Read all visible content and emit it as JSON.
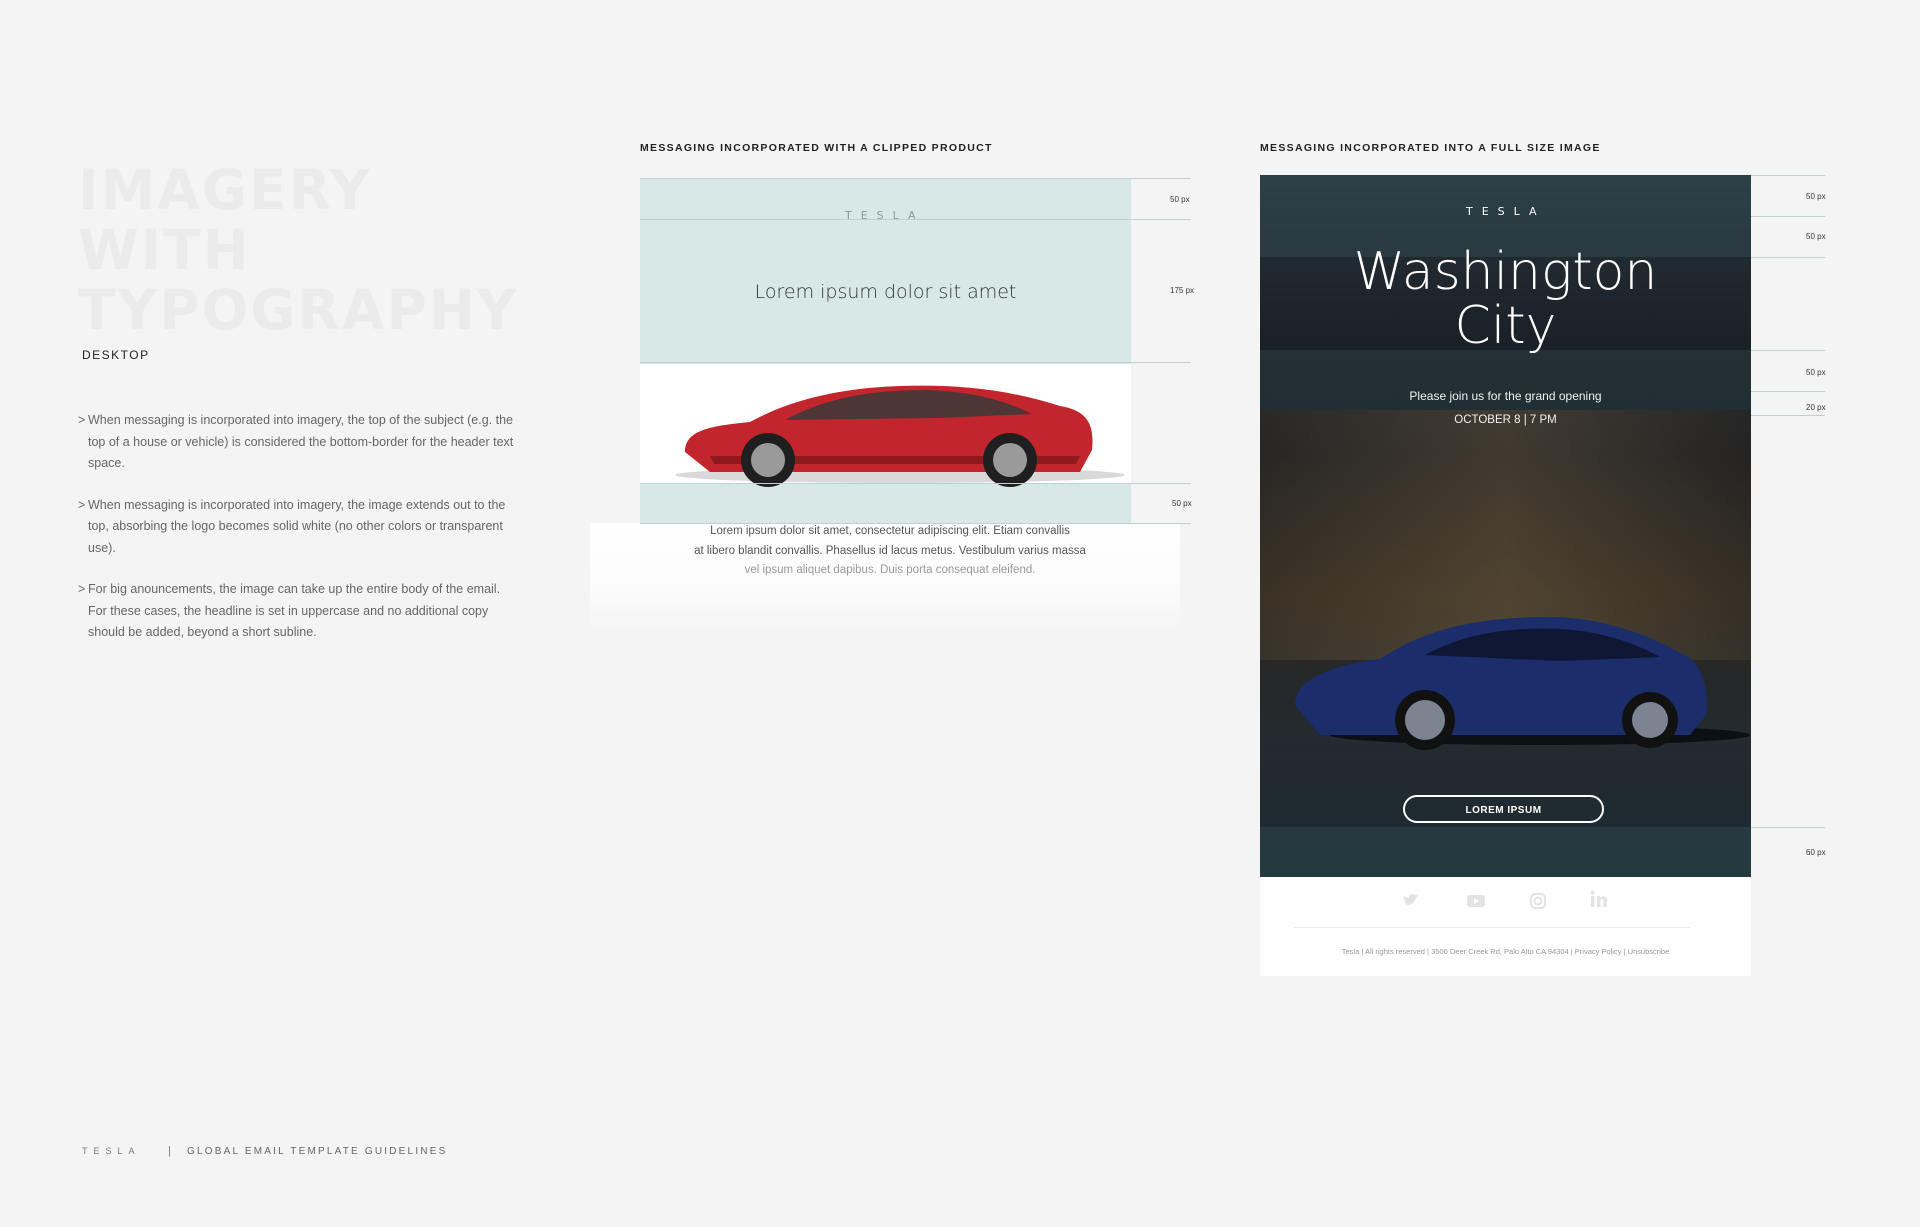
{
  "left": {
    "title_lines": [
      "IMAGERY",
      "WITH",
      "TYPOGRAPHY"
    ],
    "subhead": "DESKTOP",
    "bullets": [
      {
        "mark": ">",
        "text": "When messaging is incorporated into imagery, the top of the subject (e.g. the top of a house or vehicle) is considered the bottom-border for the header text space."
      },
      {
        "mark": ">",
        "text": "When messaging is incorporated into imagery, the image extends out to the top, absorbing the logo becomes solid white (no other colors or transparent use)."
      },
      {
        "mark": ">",
        "text": "For big anouncements, the image can take up the entire body of the email. For these cases, the headline is set in uppercase and no additional copy should be added, beyond a short subline."
      }
    ]
  },
  "clipped": {
    "label": "MESSAGING INCORPORATED WITH A CLIPPED PRODUCT",
    "logo": "TESLA",
    "headline": "Lorem ipsum dolor sit amet",
    "body_lines": [
      "Lorem ipsum dolor sit amet, consectetur adipiscing elit. Etiam convallis",
      "at libero blandit convallis. Phasellus id lacus metus. Vestibulum varius massa",
      "vel ipsum aliquet dapibus. Duis porta consequat eleifend."
    ],
    "px_labels": [
      "50 px",
      "175 px",
      "50 px"
    ]
  },
  "full": {
    "label": "MESSAGING INCORPORATED INTO A FULL SIZE IMAGE",
    "logo": "TESLA",
    "headline_lines": [
      "Washington",
      "City"
    ],
    "invite": "Please join us for the grand opening",
    "date": "OCTOBER 8 | 7 PM",
    "cta": "LOREM IPSUM",
    "px_labels": [
      "50 px",
      "50 px",
      "50 px",
      "20 px",
      "60 px"
    ],
    "footer": "Tesla  |  All rights reserved  |  3500 Deer Creek Rd, Palo Alto CA 94304  |  Privacy Policy  |  Unsubscribe",
    "social_icons": [
      "twitter-icon",
      "youtube-icon",
      "instagram-icon",
      "linkedin-icon"
    ]
  },
  "page_footer": {
    "brand": "TESLA",
    "separator": "|",
    "title": "GLOBAL EMAIL TEMPLATE GUIDELINES"
  },
  "colors": {
    "background": "#f4f4f4",
    "mint": "#d7e8e7",
    "car_red": "#c2262c",
    "car_blue": "#1b2d6b"
  }
}
